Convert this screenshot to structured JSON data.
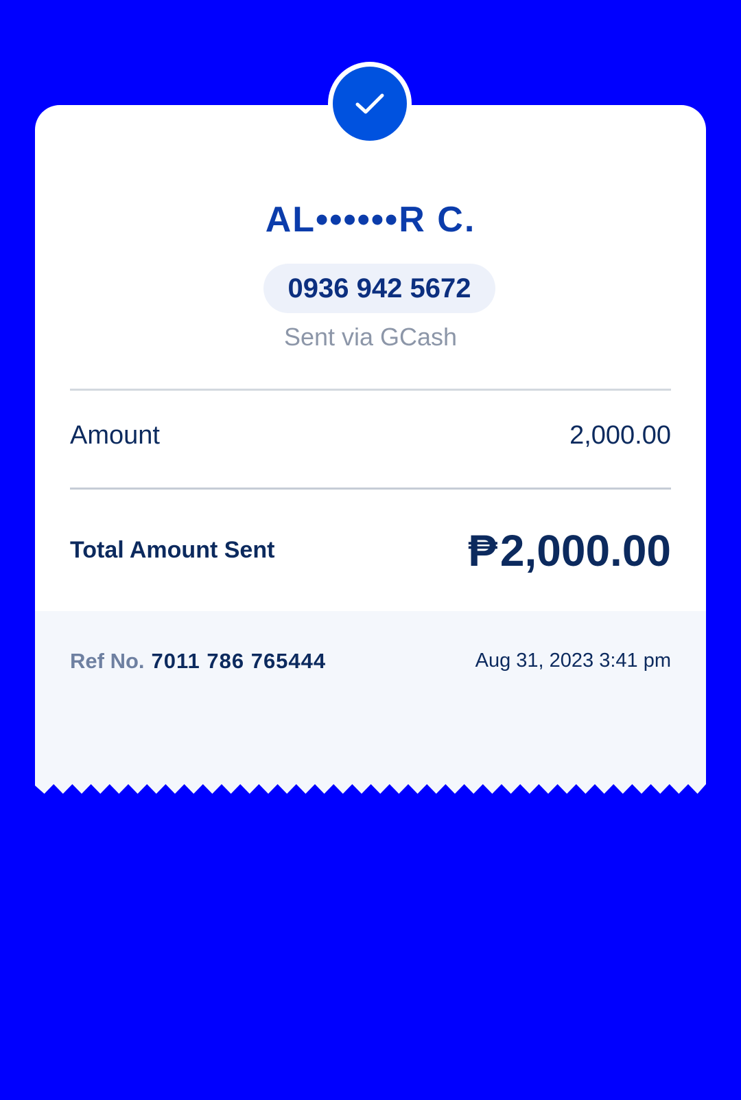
{
  "colors": {
    "background": "#0000ff",
    "accent": "#0052df",
    "name_text": "#0b3cab",
    "primary_text": "#0c2a5e",
    "muted_text": "#8c96a8"
  },
  "status": {
    "icon": "checkmark-icon"
  },
  "recipient": {
    "name": "AL••••••R C.",
    "phone": "0936 942 5672",
    "channel": "Sent via GCash"
  },
  "summary": {
    "amount_label": "Amount",
    "amount_value": "2,000.00",
    "total_label": "Total Amount Sent",
    "currency_symbol": "₱",
    "total_value": "2,000.00"
  },
  "footer": {
    "ref_label": "Ref No.",
    "ref_number": "7011 786 765444",
    "datetime": "Aug 31, 2023 3:41 pm"
  }
}
